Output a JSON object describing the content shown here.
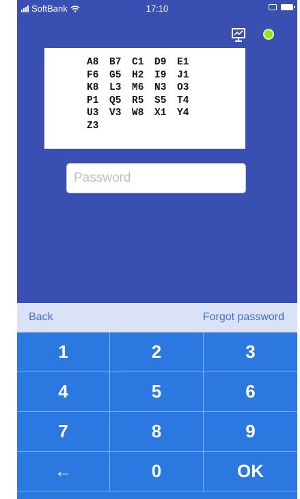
{
  "status_bar": {
    "carrier": "SoftBank",
    "time": "17:10"
  },
  "header": {
    "icons": [
      "monitor-chart-icon",
      "status-dot-icon"
    ],
    "status_dot_color": "#9ae21f"
  },
  "code_grid": {
    "rows": [
      [
        "A8",
        "B7",
        "C1",
        "D9",
        "E1"
      ],
      [
        "F6",
        "G5",
        "H2",
        "I9",
        "J1"
      ],
      [
        "K8",
        "L3",
        "M6",
        "N3",
        "O3"
      ],
      [
        "P1",
        "Q5",
        "R5",
        "S5",
        "T4"
      ],
      [
        "U3",
        "V3",
        "W8",
        "X1",
        "Y4"
      ],
      [
        "Z3"
      ]
    ]
  },
  "password": {
    "placeholder": "Password",
    "value": ""
  },
  "links": {
    "back": "Back",
    "forgot": "Forgot password"
  },
  "keypad": {
    "keys": [
      "1",
      "2",
      "3",
      "4",
      "5",
      "6",
      "7",
      "8",
      "9",
      "←",
      "0",
      "OK"
    ]
  },
  "colors": {
    "background": "#3a4fb2",
    "keypad": "#2a78e0",
    "link_bar": "#dce2f6",
    "link_text": "#3c6fd2"
  }
}
